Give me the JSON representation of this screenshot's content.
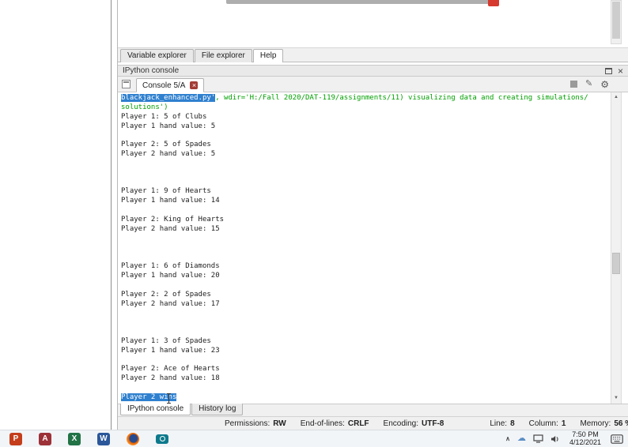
{
  "explorer_tabs": {
    "items": [
      {
        "label": "Variable explorer",
        "active": false
      },
      {
        "label": "File explorer",
        "active": false
      },
      {
        "label": "Help",
        "active": true
      }
    ]
  },
  "ipython_pane": {
    "title": "IPython console"
  },
  "console_tabbar": {
    "tab_label": "Console 5/A"
  },
  "console": {
    "selection_color": "#2f80cf",
    "green": "#00a000",
    "lines": [
      {
        "segments": [
          {
            "text": "blackjack_enhanced.py'",
            "style": "selected"
          },
          {
            "text": ", wdir='H:/Fall 2020/DAT-119/assignments/11) visualizing data and creating simulations/",
            "style": "green"
          }
        ]
      },
      {
        "text": "solutions')",
        "style": "green"
      },
      {
        "text": "Player 1: 5 of Clubs",
        "style": "normal"
      },
      {
        "text": "Player 1 hand value: 5",
        "style": "normal"
      },
      {
        "text": "",
        "style": "blank"
      },
      {
        "text": "Player 2: 5 of Spades",
        "style": "normal"
      },
      {
        "text": "Player 2 hand value: 5",
        "style": "normal"
      },
      {
        "text": "",
        "style": "blank"
      },
      {
        "text": "",
        "style": "blank"
      },
      {
        "text": "",
        "style": "blank"
      },
      {
        "text": "Player 1: 9 of Hearts",
        "style": "normal"
      },
      {
        "text": "Player 1 hand value: 14",
        "style": "normal"
      },
      {
        "text": "",
        "style": "blank"
      },
      {
        "text": "Player 2: King of Hearts",
        "style": "normal"
      },
      {
        "text": "Player 2 hand value: 15",
        "style": "normal"
      },
      {
        "text": "",
        "style": "blank"
      },
      {
        "text": "",
        "style": "blank"
      },
      {
        "text": "",
        "style": "blank"
      },
      {
        "text": "Player 1: 6 of Diamonds",
        "style": "normal"
      },
      {
        "text": "Player 1 hand value: 20",
        "style": "normal"
      },
      {
        "text": "",
        "style": "blank"
      },
      {
        "text": "Player 2: 2 of Spades",
        "style": "normal"
      },
      {
        "text": "Player 2 hand value: 17",
        "style": "normal"
      },
      {
        "text": "",
        "style": "blank"
      },
      {
        "text": "",
        "style": "blank"
      },
      {
        "text": "",
        "style": "blank"
      },
      {
        "text": "Player 1: 3 of Spades",
        "style": "normal"
      },
      {
        "text": "Player 1 hand value: 23",
        "style": "normal"
      },
      {
        "text": "",
        "style": "blank"
      },
      {
        "text": "Player 2: Ace of Hearts",
        "style": "normal"
      },
      {
        "text": "Player 2 hand value: 18",
        "style": "normal"
      },
      {
        "text": "",
        "style": "blank"
      },
      {
        "text": "Player 2 wins",
        "style": "selected"
      }
    ]
  },
  "bottom_tabs": {
    "items": [
      {
        "label": "IPython console",
        "active": true
      },
      {
        "label": "History log",
        "active": false
      }
    ]
  },
  "status_bar": {
    "items": [
      {
        "label": "Permissions:",
        "value": "RW"
      },
      {
        "label": "End-of-lines:",
        "value": "CRLF"
      },
      {
        "label": "Encoding:",
        "value": "UTF-8"
      },
      {
        "label": "Line:",
        "value": "8"
      },
      {
        "label": "Column:",
        "value": "1"
      },
      {
        "label": "Memory:",
        "value": "56 %"
      }
    ]
  },
  "taskbar": {
    "apps": [
      {
        "name": "powerpoint",
        "letter": "P",
        "color": "#c43e1c"
      },
      {
        "name": "access",
        "letter": "A",
        "color": "#9c3138"
      },
      {
        "name": "excel",
        "letter": "X",
        "color": "#217346"
      },
      {
        "name": "word",
        "letter": "W",
        "color": "#2b579a"
      },
      {
        "name": "firefox",
        "letter": "",
        "color": ""
      },
      {
        "name": "camera",
        "letter": "",
        "color": ""
      }
    ],
    "clock": {
      "time": "7:50 PM",
      "date": "4/12/2021"
    }
  },
  "icons": {
    "close_x": "×",
    "gear": "⚙",
    "pencil": "✎",
    "chevron_up": "∧",
    "cloud": "☁",
    "scroll_up": "▲",
    "scroll_down": "▼"
  }
}
